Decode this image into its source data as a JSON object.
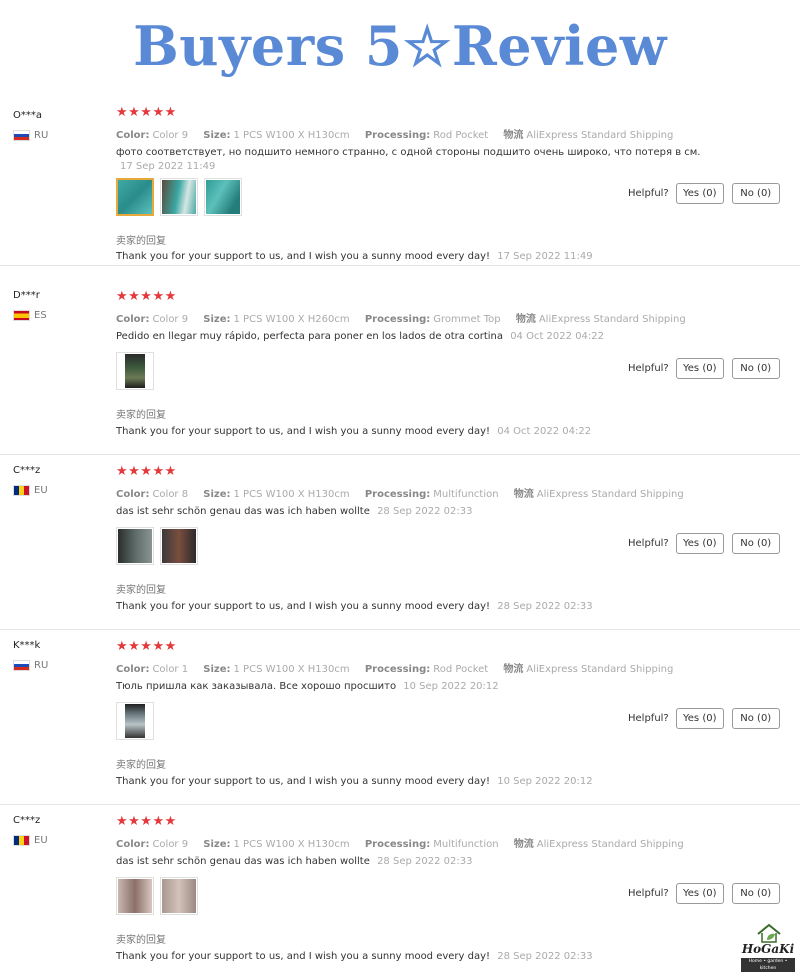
{
  "banner": {
    "title": "Buyers 5☆Review"
  },
  "labels": {
    "color": "Color:",
    "size": "Size:",
    "processing": "Processing:",
    "shipping": "物流",
    "reply_title": "卖家的回复",
    "helpful": "Helpful?",
    "yes": "Yes (0)",
    "no": "No (0)"
  },
  "rating_stars": "★★★★★",
  "reviews": [
    {
      "user": "O***a",
      "country": "RU",
      "flag": "ru",
      "color": "Color 9",
      "size": "1 PCS W100 X H130cm",
      "processing": "Rod Pocket",
      "shipping": "AliExpress Standard Shipping",
      "text": "фото соответствует, но подшито немного странно, с одной стороны подшито очень широко, что потеря в см.",
      "date": "17 Sep 2022 11:49",
      "reply": "Thank you for your support to us, and I wish you a sunny mood every day!",
      "reply_date": "17 Sep 2022 11:49"
    },
    {
      "user": "D***r",
      "country": "ES",
      "flag": "es",
      "color": "Color 9",
      "size": "1 PCS W100 X H260cm",
      "processing": "Grommet Top",
      "shipping": "AliExpress Standard Shipping",
      "text": "Pedido en llegar muy rápido, perfecta para poner en los lados de otra cortina",
      "date": "04 Oct 2022 04:22",
      "reply": "Thank you for your support to us, and I wish you a sunny mood every day!",
      "reply_date": "04 Oct 2022 04:22"
    },
    {
      "user": "C***z",
      "country": "EU",
      "flag": "eu",
      "color": "Color 8",
      "size": "1 PCS W100 X H130cm",
      "processing": "Multifunction",
      "shipping": "AliExpress Standard Shipping",
      "text": "das ist sehr schön genau das was ich haben wollte",
      "date": "28 Sep 2022 02:33",
      "reply": "Thank you for your support to us, and I wish you a sunny mood every day!",
      "reply_date": "28 Sep 2022 02:33"
    },
    {
      "user": "K***k",
      "country": "RU",
      "flag": "ru",
      "color": "Color 1",
      "size": "1 PCS W100 X H130cm",
      "processing": "Rod Pocket",
      "shipping": "AliExpress Standard Shipping",
      "text": "Тюль пришла как заказывала. Все хорошо просшито",
      "date": "10 Sep 2022 20:12",
      "reply": "Thank you for your support to us, and I wish you a sunny mood every day!",
      "reply_date": "10 Sep 2022 20:12"
    },
    {
      "user": "C***z",
      "country": "EU",
      "flag": "eu",
      "color": "Color 9",
      "size": "1 PCS W100 X H130cm",
      "processing": "Multifunction",
      "shipping": "AliExpress Standard Shipping",
      "text": "das ist sehr schön genau das was ich haben wollte",
      "date": "28 Sep 2022 02:33",
      "reply": "Thank you for your support to us, and I wish you a sunny mood every day!",
      "reply_date": "28 Sep 2022 02:33"
    }
  ],
  "logo": {
    "name": "HoGaKi",
    "tagline": "Home • garden • kitchen"
  }
}
